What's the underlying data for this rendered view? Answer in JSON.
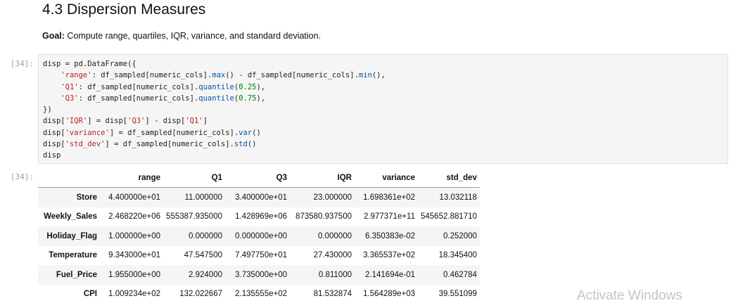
{
  "markdown": {
    "title": "4.3 Dispersion Measures",
    "goal_label": "Goal:",
    "goal_text": " Compute range, quartiles, IQR, variance, and standard deviation."
  },
  "code_cell": {
    "prompt": "[34]:",
    "lines": [
      "disp = pd.DataFrame({",
      "    'range': df_sampled[numeric_cols].max() - df_sampled[numeric_cols].min(),",
      "    'Q1': df_sampled[numeric_cols].quantile(0.25),",
      "    'Q3': df_sampled[numeric_cols].quantile(0.75),",
      "})",
      "disp['IQR'] = disp['Q3'] - disp['Q1']",
      "disp['variance'] = df_sampled[numeric_cols].var()",
      "disp['std_dev'] = df_sampled[numeric_cols].std()",
      "disp"
    ]
  },
  "output": {
    "prompt": "[34]:",
    "columns": [
      "range",
      "Q1",
      "Q3",
      "IQR",
      "variance",
      "std_dev"
    ],
    "rows": [
      {
        "index": "Store",
        "values": [
          "4.400000e+01",
          "11.000000",
          "3.400000e+01",
          "23.000000",
          "1.698361e+02",
          "13.032118"
        ]
      },
      {
        "index": "Weekly_Sales",
        "values": [
          "2.468220e+06",
          "555387.935000",
          "1.428969e+06",
          "873580.937500",
          "2.977371e+11",
          "545652.881710"
        ]
      },
      {
        "index": "Holiday_Flag",
        "values": [
          "1.000000e+00",
          "0.000000",
          "0.000000e+00",
          "0.000000",
          "6.350383e-02",
          "0.252000"
        ]
      },
      {
        "index": "Temperature",
        "values": [
          "9.343000e+01",
          "47.547500",
          "7.497750e+01",
          "27.430000",
          "3.365537e+02",
          "18.345400"
        ]
      },
      {
        "index": "Fuel_Price",
        "values": [
          "1.955000e+00",
          "2.924000",
          "3.735000e+00",
          "0.811000",
          "2.141694e-01",
          "0.462784"
        ]
      },
      {
        "index": "CPI",
        "values": [
          "1.009234e+02",
          "132.022667",
          "2.135555e+02",
          "81.532874",
          "1.564289e+03",
          "39.551099"
        ]
      }
    ]
  },
  "watermark": "Activate Windows"
}
